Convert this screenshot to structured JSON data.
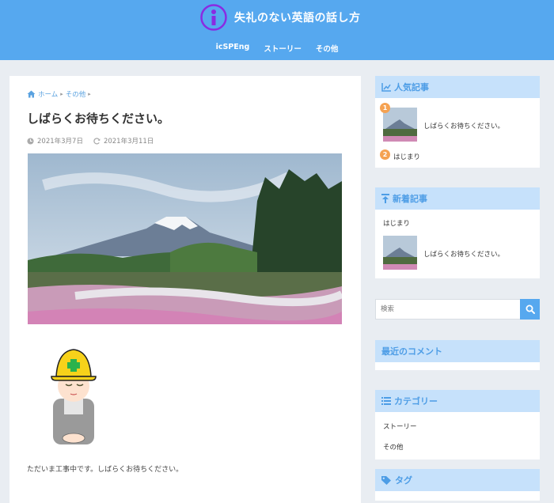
{
  "site": {
    "title": "失礼のない英語の話し方",
    "logo_icon": "info-circle-logo"
  },
  "nav": {
    "items": [
      {
        "label": "icSPEng"
      },
      {
        "label": "ストーリー"
      },
      {
        "label": "その他"
      }
    ]
  },
  "breadcrumb": {
    "home": "ホーム",
    "category": "その他"
  },
  "post": {
    "title": "しばらくお待ちください。",
    "published": "2021年3月7日",
    "updated": "2021年3月11日",
    "body": "ただいま工事中です。しばらくお待ちください。"
  },
  "popular": {
    "heading": "人気記事",
    "items": [
      {
        "rank": "1",
        "title": "しばらくお待ちください。"
      },
      {
        "rank": "2",
        "title": "はじまり"
      }
    ]
  },
  "recent": {
    "heading": "新着記事",
    "items": [
      {
        "title": "はじまり"
      },
      {
        "title": "しばらくお待ちください。"
      }
    ]
  },
  "search": {
    "placeholder": "検索"
  },
  "comments": {
    "heading": "最近のコメント"
  },
  "categories": {
    "heading": "カテゴリー",
    "items": [
      {
        "label": "ストーリー"
      },
      {
        "label": "その他"
      }
    ]
  },
  "tags": {
    "heading": "タグ"
  },
  "colors": {
    "header": "#56a8ef",
    "widget_head": "#c6e1fb",
    "accent": "#4d9de6",
    "badge": "#f5a252"
  }
}
